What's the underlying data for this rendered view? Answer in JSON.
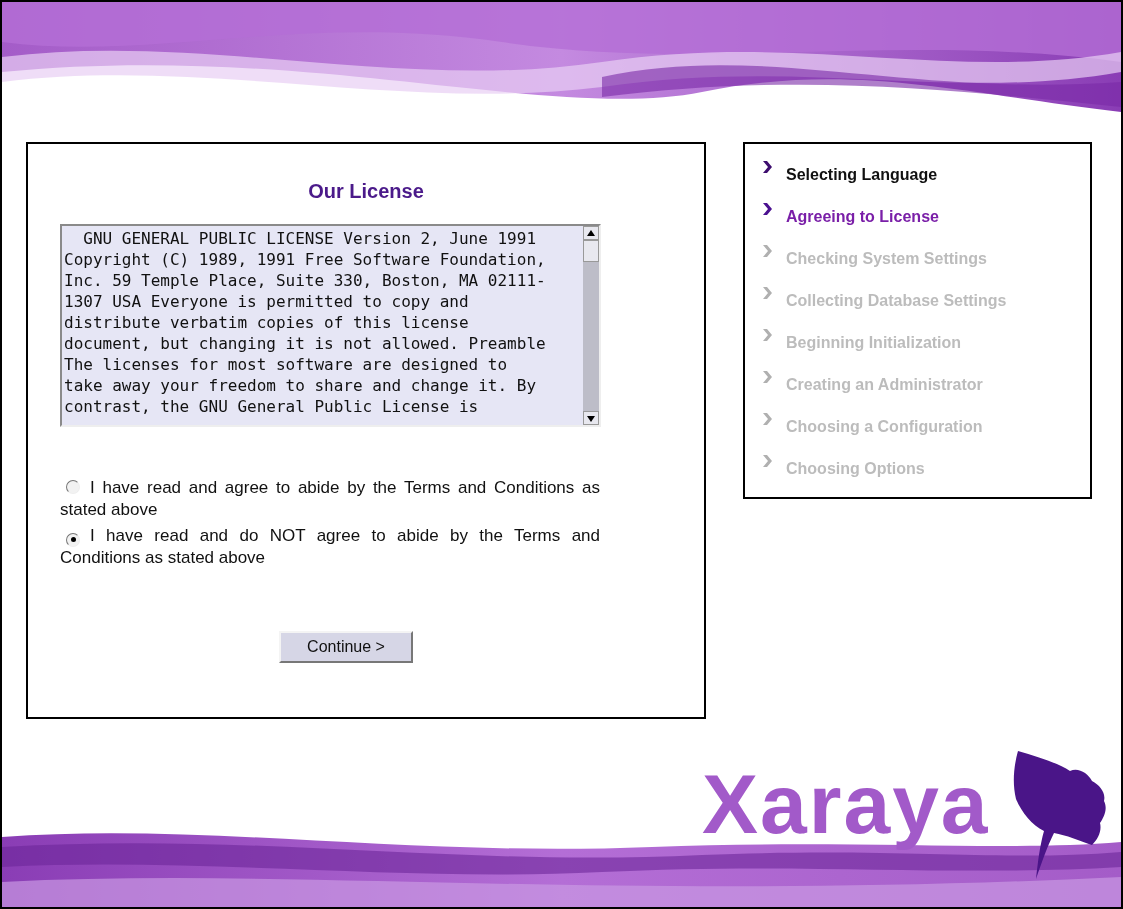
{
  "license_panel": {
    "title": "Our License",
    "license_text": "  GNU GENERAL PUBLIC LICENSE Version 2, June 1991 Copyright (C) 1989, 1991 Free Software Foundation, Inc. 59 Temple Place, Suite 330, Boston, MA 02111-1307 USA Everyone is permitted to copy and distribute verbatim copies of this license document, but changing it is not allowed. Preamble The licenses for most software are designed to take away your freedom to share and change it. By contrast, the GNU General Public License is",
    "options": [
      {
        "label": "I have read and agree to abide by the Terms and Conditions as stated above",
        "selected": false
      },
      {
        "label": "I have read and do NOT agree to abide by the Terms and Conditions as stated above",
        "selected": true
      }
    ],
    "button": "Continue >"
  },
  "steps": [
    {
      "label": "Selecting Language",
      "selected": false,
      "disabled": false
    },
    {
      "label": "Agreeing to License",
      "selected": true,
      "disabled": false
    },
    {
      "label": "Checking System Settings",
      "selected": false,
      "disabled": true
    },
    {
      "label": "Collecting Database Settings",
      "selected": false,
      "disabled": true
    },
    {
      "label": "Beginning Initialization",
      "selected": false,
      "disabled": true
    },
    {
      "label": "Creating an Administrator",
      "selected": false,
      "disabled": true
    },
    {
      "label": "Choosing a Configuration",
      "selected": false,
      "disabled": true
    },
    {
      "label": "Choosing Options",
      "selected": false,
      "disabled": true
    }
  ],
  "logo": {
    "text": "Xaraya"
  }
}
